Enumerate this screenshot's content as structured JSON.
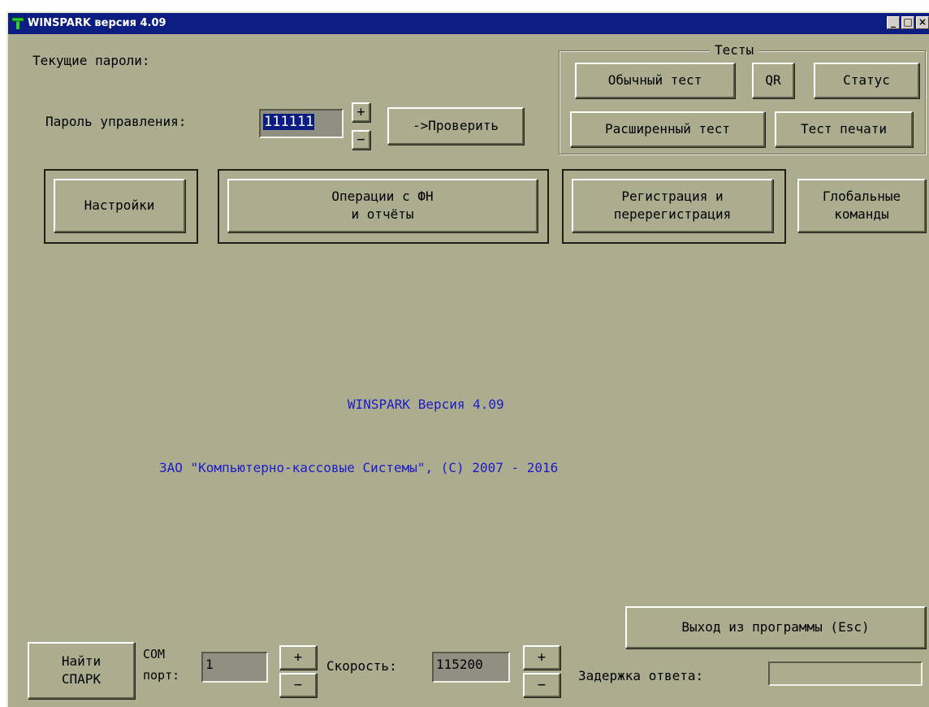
{
  "window": {
    "title": "WINSPARK версия 4.09",
    "controls": [
      "_",
      "□",
      "×"
    ]
  },
  "passwords": {
    "header": "Текущие пароли:",
    "control_label": "Пароль управления:",
    "control_value": "111111",
    "plus": "+",
    "minus": "−",
    "check_button": "->Проверить"
  },
  "tests": {
    "title": "Тесты",
    "normal": "Обычный тест",
    "qr": "QR",
    "status": "Статус",
    "extended": "Расширенный тест",
    "print_test": "Тест печати"
  },
  "main_buttons": {
    "settings": "Настройки",
    "fn_operations": "Операции с ФН\nи отчёты",
    "registration": "Регистрация и\nперерегистрация",
    "global": "Глобальные\nкоманды"
  },
  "about": {
    "version": "WINSPARK  Версия 4.09",
    "copyright": "ЗАО \"Компьютерно-кассовые Системы\", (С) 2007 - 2016"
  },
  "bottom": {
    "exit_button": "Выход из программы (Esc)",
    "find_button": "Найти\nСПАРК",
    "com_label_1": "COM",
    "com_label_2": "порт:",
    "com_value": "1",
    "speed_label": "Скорость:",
    "speed_value": "115200",
    "plus": "+",
    "minus": "−",
    "delay_label": "Задержка ответа:",
    "delay_value": ""
  },
  "colors": {
    "background": "#acac8e",
    "titlebar": "#0c1d82",
    "about_text": "#1c1cc8"
  }
}
